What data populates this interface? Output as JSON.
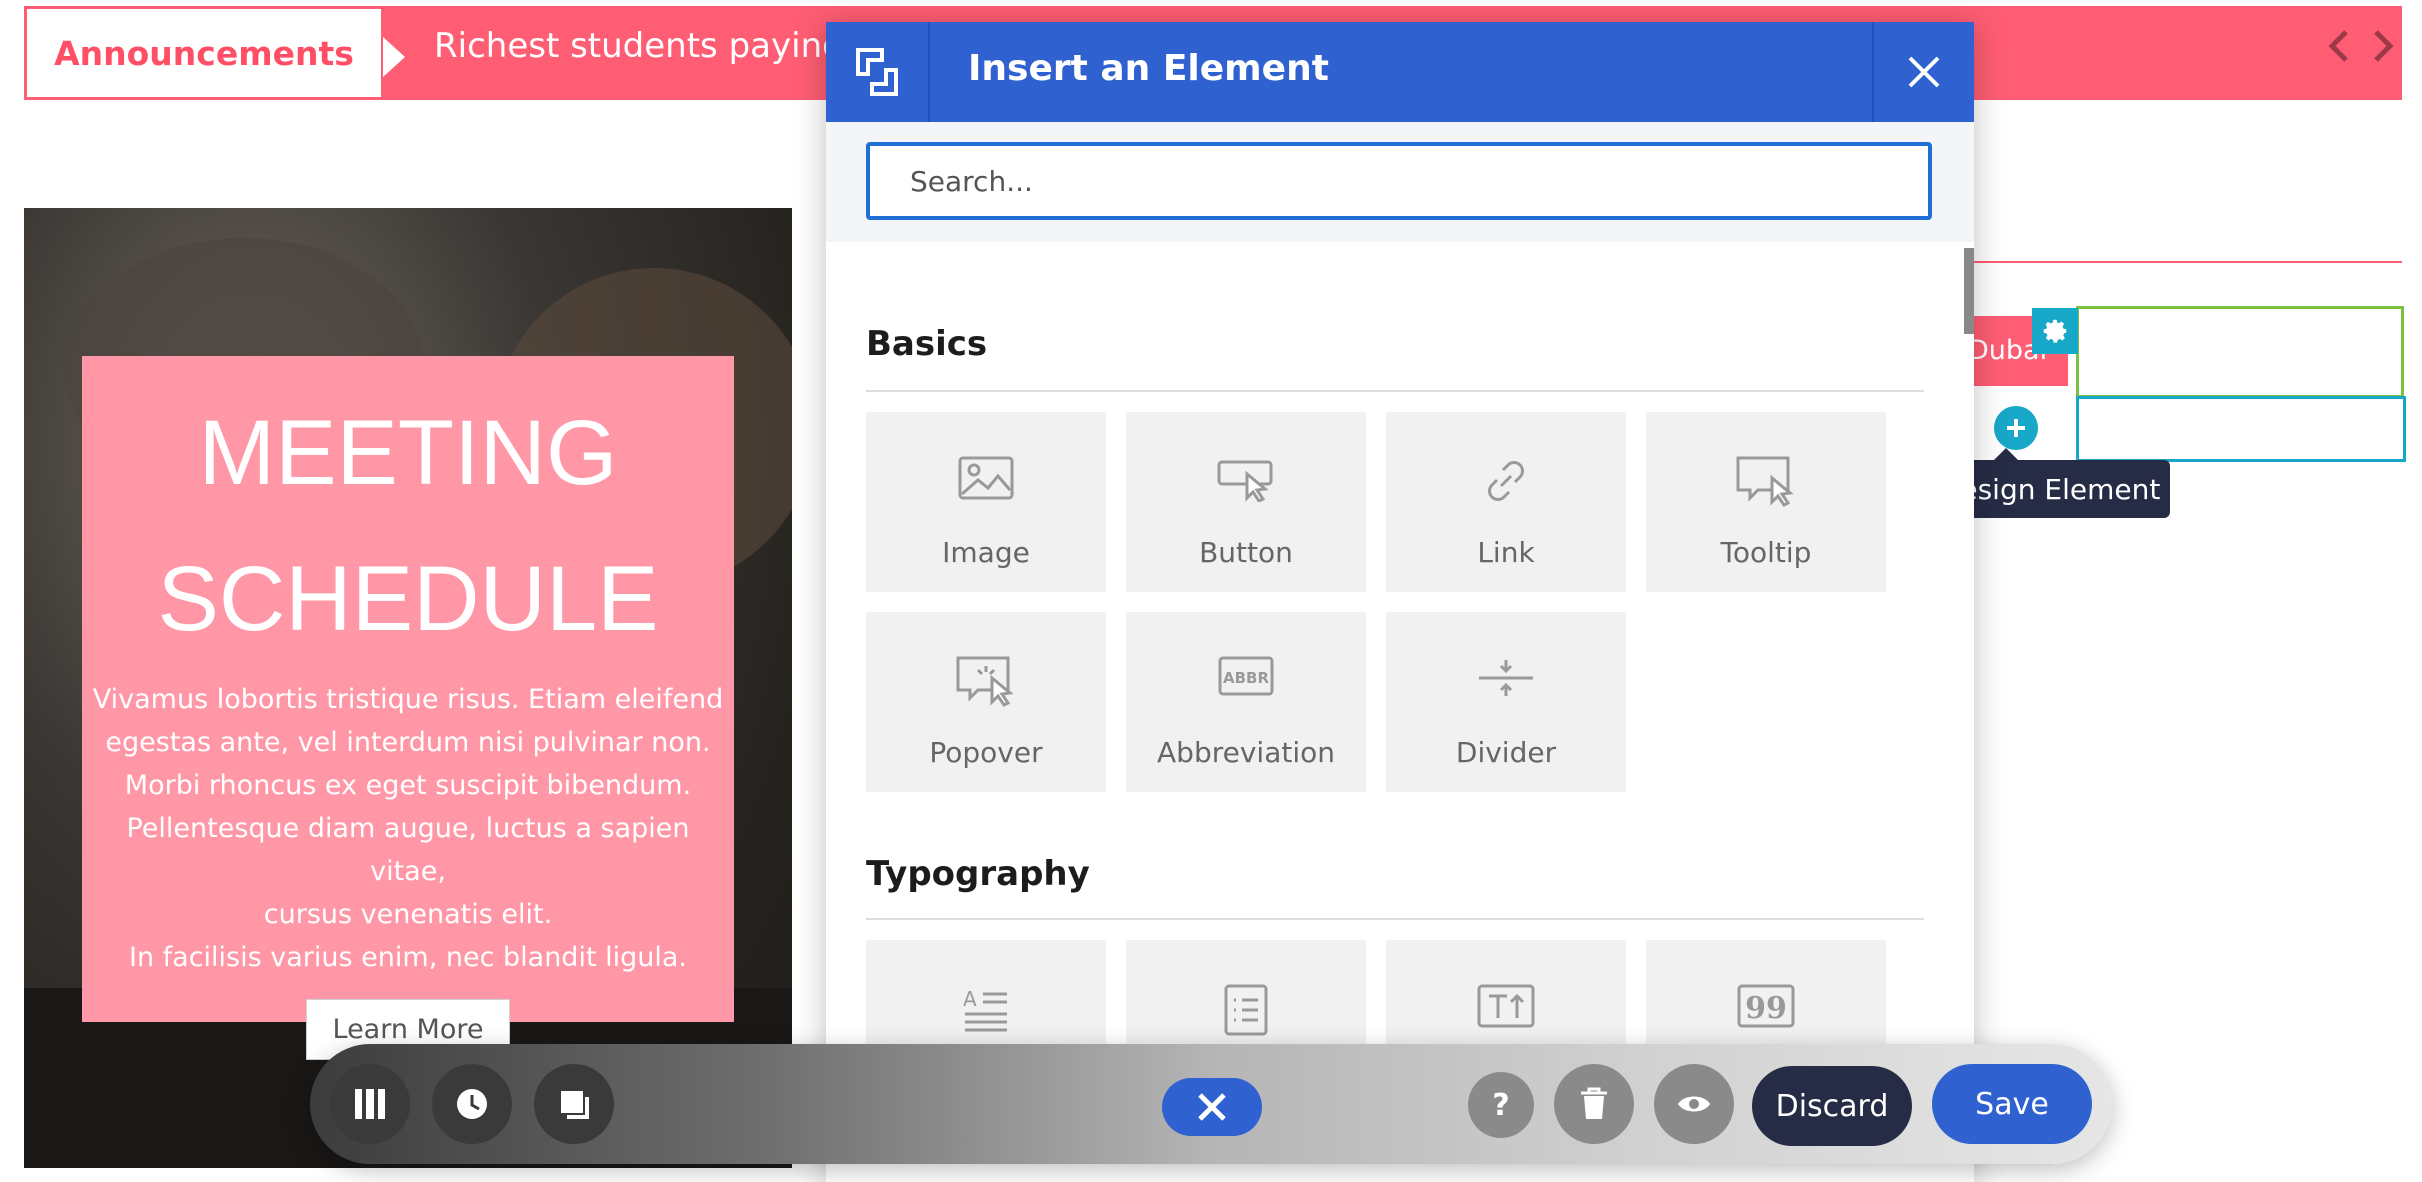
{
  "announcements": {
    "tab_label": "Announcements",
    "ticker_text": "Richest students paying l",
    "code_icon": "code-icon"
  },
  "hero": {
    "title_line1": "MEETING",
    "title_line2": "SCHEDULE",
    "body_lines": [
      "Vivamus lobortis tristique risus. Etiam eleifend",
      "egestas ante, vel interdum nisi pulvinar non.",
      "Morbi rhoncus ex eget suscipit bibendum.",
      "Pellentesque diam augue, luctus a sapien vitae,",
      "cursus venenatis elit.",
      "In facilisis varius enim, nec blandit ligula."
    ],
    "button_label": "Learn More"
  },
  "builder": {
    "pill_text": "Dubai",
    "tooltip": "Add Design Element"
  },
  "modal": {
    "title": "Insert an Element",
    "search_placeholder": "Search...",
    "sections": [
      {
        "title": "Basics",
        "items": [
          {
            "label": "Image",
            "icon": "image-icon"
          },
          {
            "label": "Button",
            "icon": "button-icon"
          },
          {
            "label": "Link",
            "icon": "link-icon"
          },
          {
            "label": "Tooltip",
            "icon": "tooltip-icon"
          },
          {
            "label": "Popover",
            "icon": "popover-icon"
          },
          {
            "label": "Abbreviation",
            "icon": "abbreviation-icon"
          },
          {
            "label": "Divider",
            "icon": "divider-icon"
          }
        ]
      },
      {
        "title": "Typography",
        "items": [
          {
            "label": "",
            "icon": "text-icon"
          },
          {
            "label": "",
            "icon": "list-icon"
          },
          {
            "label": "",
            "icon": "heading-icon"
          },
          {
            "label": "",
            "icon": "quote-icon"
          }
        ]
      }
    ],
    "abbr_text": "ABBR"
  },
  "toolbar": {
    "discard_label": "Discard",
    "save_label": "Save",
    "help_glyph": "?"
  },
  "colors": {
    "accent_blue": "#3061d0",
    "announce_red": "#ff5d73",
    "card_pink": "#ff97a6",
    "teal": "#17a7c8",
    "dark_navy": "#272c46"
  }
}
